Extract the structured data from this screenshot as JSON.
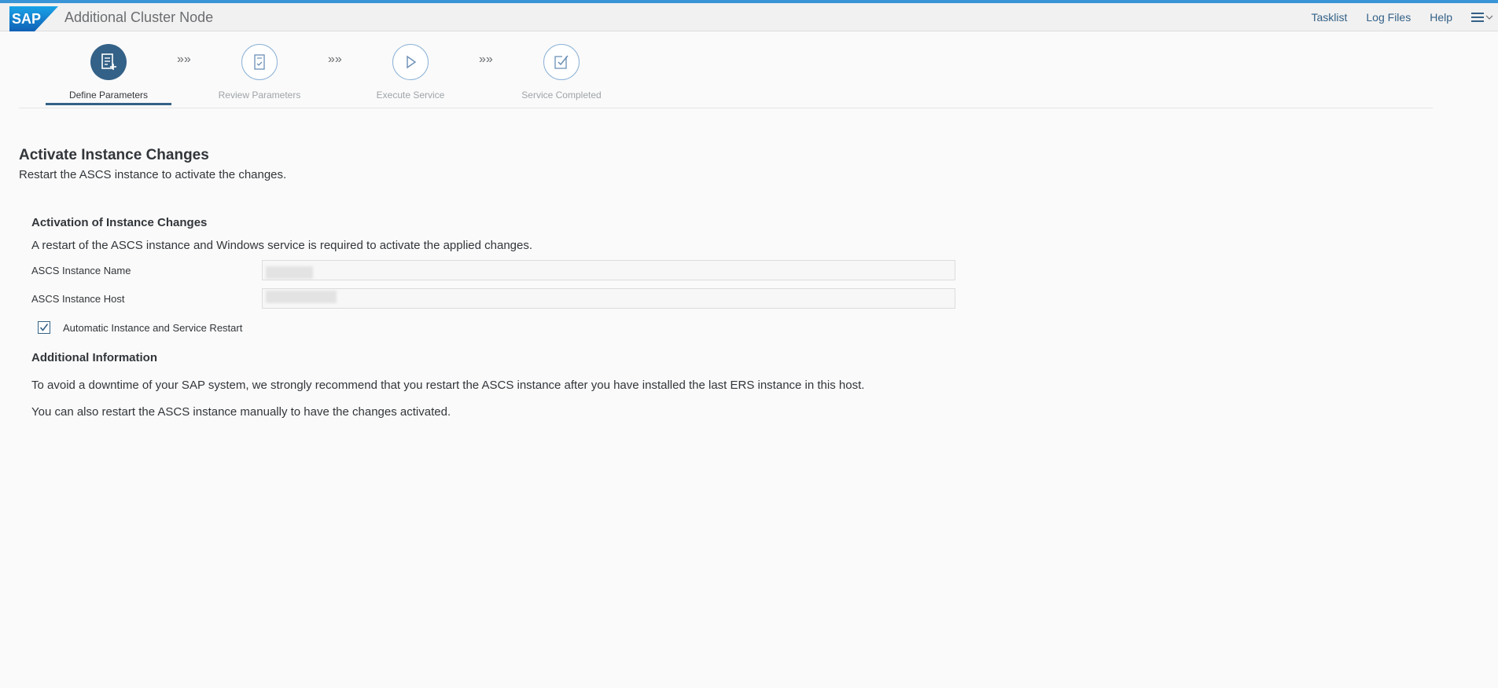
{
  "app": {
    "logo_text": "SAP",
    "title": "Additional Cluster Node"
  },
  "shell": {
    "links": [
      "Tasklist",
      "Log Files",
      "Help"
    ],
    "menu_icon": "hamburger-menu-icon"
  },
  "wizard": {
    "steps": [
      {
        "label": "Define Parameters",
        "icon": "form-edit-icon",
        "state": "active"
      },
      {
        "label": "Review Parameters",
        "icon": "document-check-icon",
        "state": "inactive"
      },
      {
        "label": "Execute Service",
        "icon": "play-icon",
        "state": "inactive"
      },
      {
        "label": "Service Completed",
        "icon": "checkbox-check-icon",
        "state": "inactive"
      }
    ],
    "separator": "»»"
  },
  "page": {
    "title": "Activate Instance Changes",
    "subtitle": "Restart the ASCS instance to activate the changes."
  },
  "activation": {
    "title": "Activation of Instance Changes",
    "description": "A restart of the ASCS instance and Windows service is required to activate the applied changes.",
    "fields": [
      {
        "label": "ASCS Instance Name",
        "value": ""
      },
      {
        "label": "ASCS Instance Host",
        "value": ""
      }
    ],
    "checkbox": {
      "label": "Automatic Instance and Service Restart",
      "checked": true
    }
  },
  "additional": {
    "title": "Additional Information",
    "line1": "To avoid a downtime of your SAP system, we strongly recommend that you restart the ASCS instance after you have installed the last ERS instance in this host.",
    "line2": "You can also restart the ASCS instance manually to have the changes activated."
  },
  "colors": {
    "accent": "#346187",
    "topline": "#3a95d6",
    "logo_blue": "#1f6fc6"
  }
}
